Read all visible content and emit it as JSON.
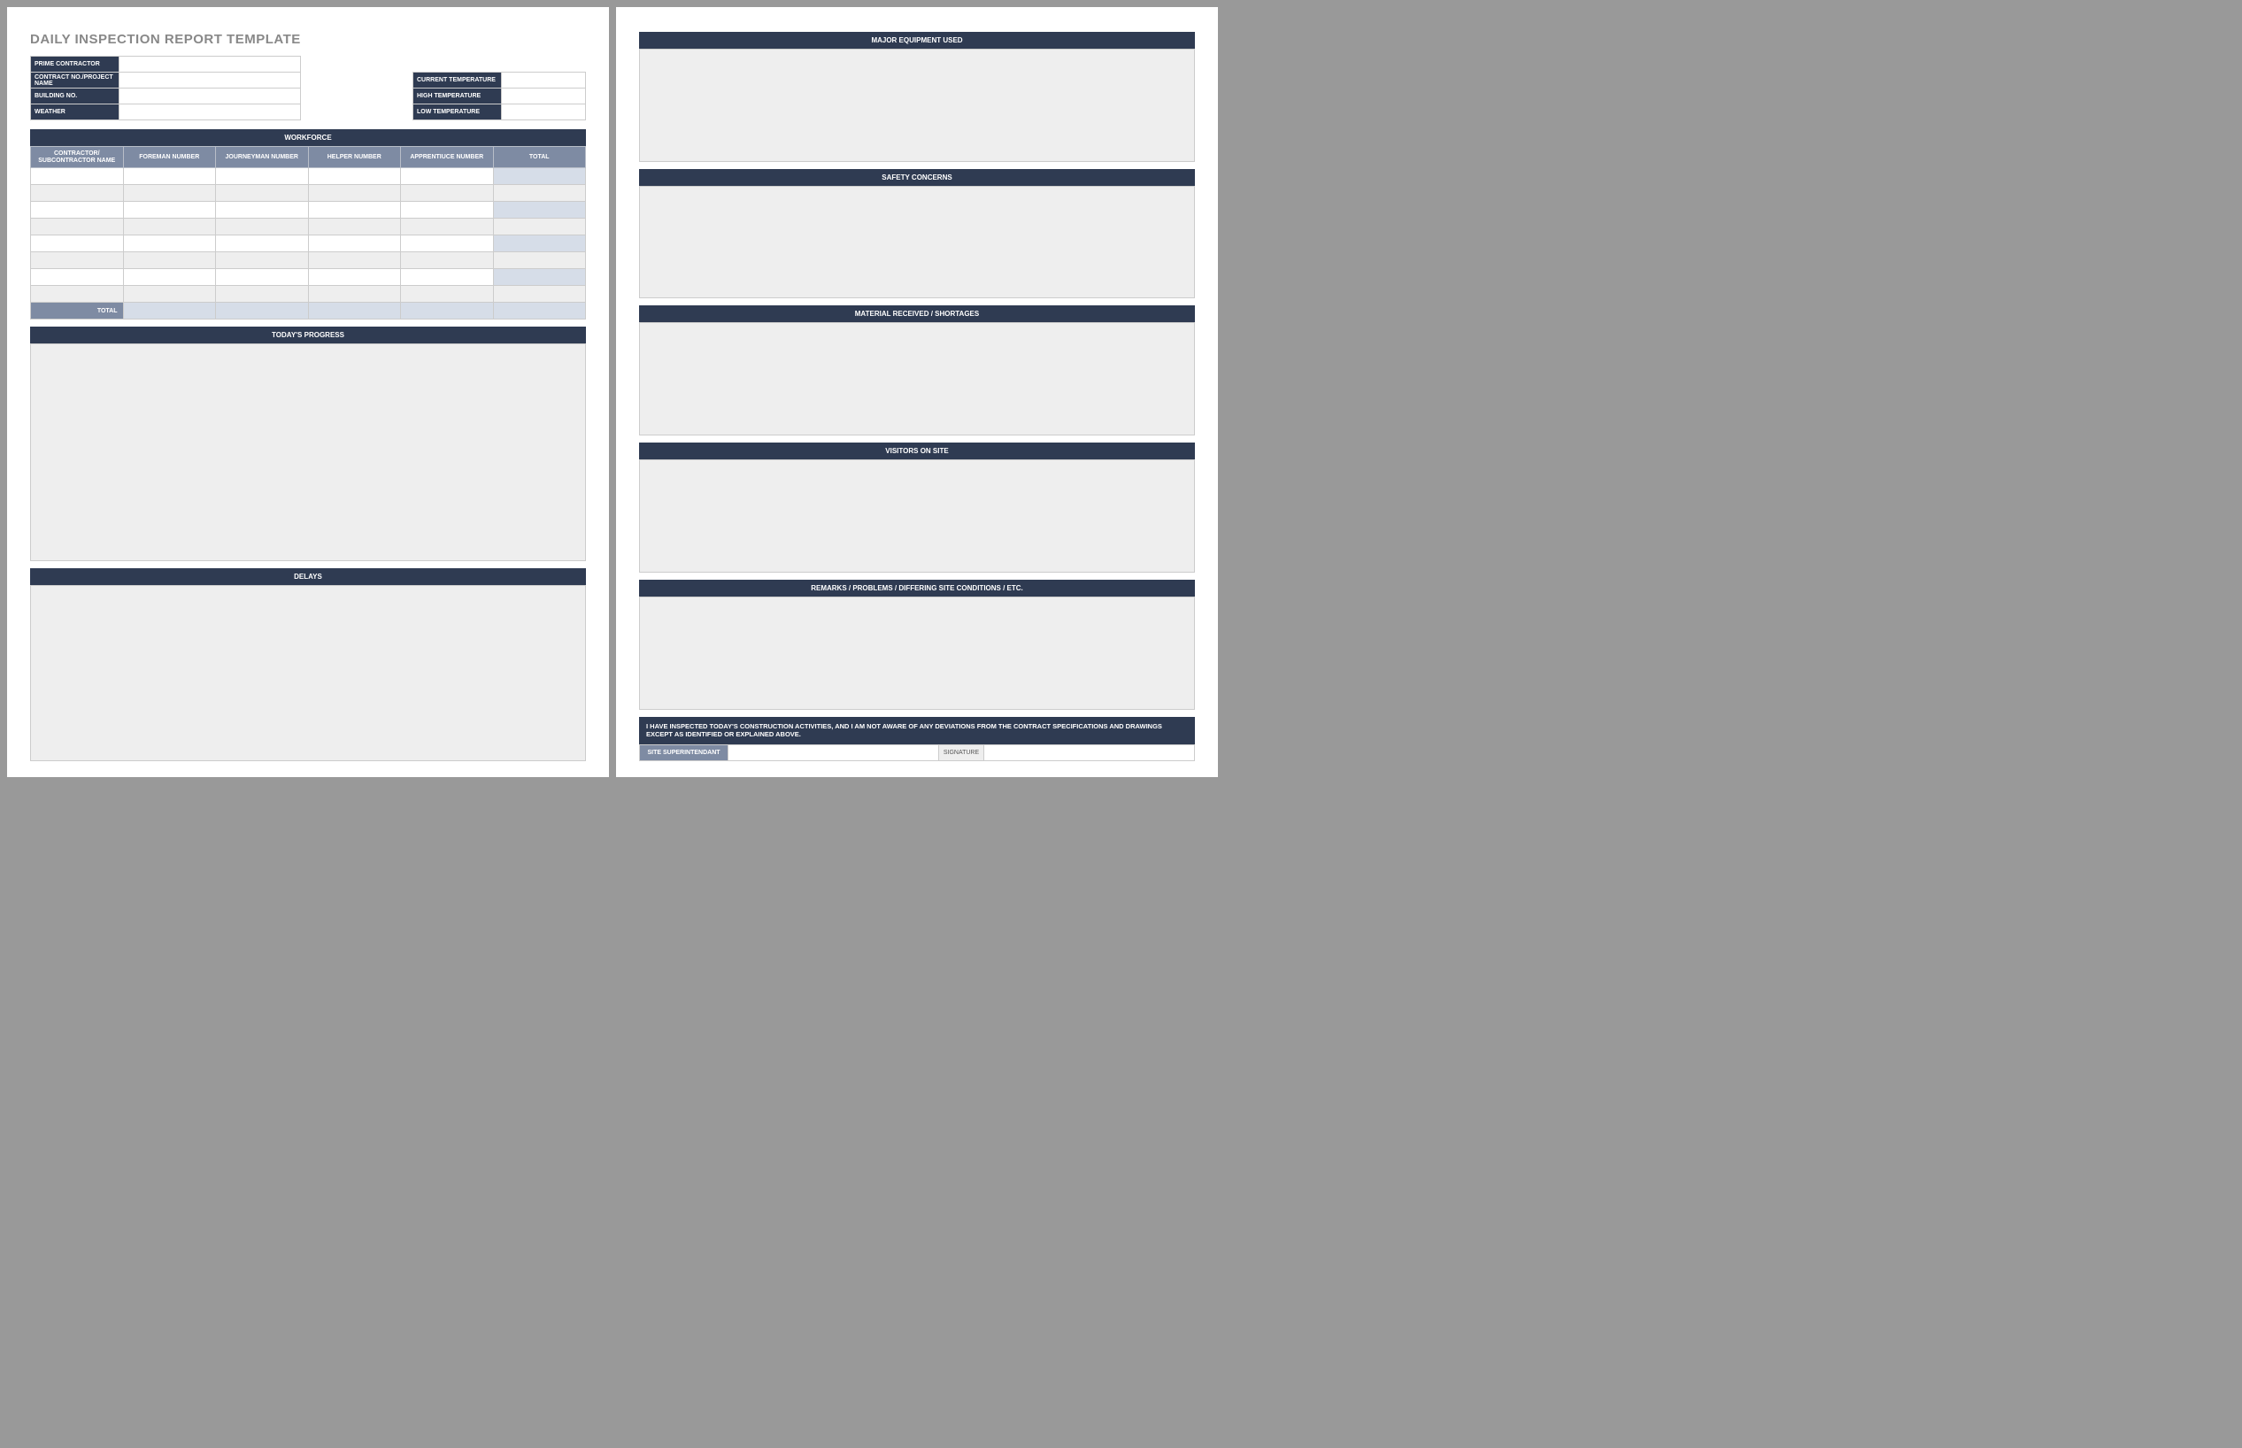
{
  "title": "DAILY INSPECTION REPORT TEMPLATE",
  "left_kv": {
    "prime_contractor": "PRIME CONTRACTOR",
    "contract_no": "CONTRACT NO./PROJECT NAME",
    "building_no": "BUILDING NO.",
    "weather": "WEATHER"
  },
  "right_kv": {
    "current_temp": "CURRENT TEMPERATURE",
    "high_temp": "HIGH TEMPERATURE",
    "low_temp": "LOW TEMPERATURE"
  },
  "workforce": {
    "header": "WORKFORCE",
    "cols": {
      "contractor": "CONTRACTOR/ SUBCONTRACTOR NAME",
      "foreman": "FOREMAN NUMBER",
      "journeyman": "JOURNEYMAN NUMBER",
      "helper": "HELPER NUMBER",
      "apprentice": "APPRENTIUCE NUMBER",
      "total": "TOTAL"
    },
    "total_label": "TOTAL"
  },
  "sections": {
    "progress": "TODAY'S PROGRESS",
    "delays": "DELAYS",
    "equipment": "MAJOR EQUIPMENT USED",
    "safety": "SAFETY CONCERNS",
    "material": "MATERIAL RECEIVED / SHORTAGES",
    "visitors": "VISITORS ON SITE",
    "remarks": "REMARKS / PROBLEMS / DIFFERING SITE CONDITIONS / ETC."
  },
  "statement": "I HAVE INSPECTED TODAY'S CONSTRUCTION ACTIVITIES, AND I AM NOT AWARE OF ANY DEVIATIONS FROM THE CONTRACT SPECIFICATIONS AND DRAWINGS EXCEPT AS IDENTIFIED OR EXPLAINED ABOVE.",
  "signature": {
    "superintendent": "SITE SUPERINTENDANT",
    "signature": "SIGNATURE"
  }
}
